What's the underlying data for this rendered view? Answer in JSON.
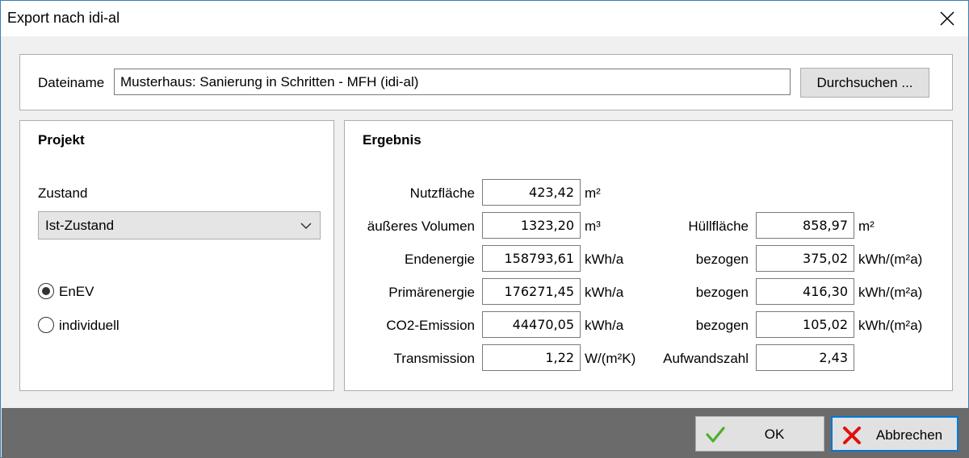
{
  "window": {
    "title": "Export nach idi-al"
  },
  "file": {
    "label": "Dateiname",
    "value": "Musterhaus: Sanierung in Schritten - MFH (idi-al)",
    "browse_label": "Durchsuchen ..."
  },
  "project": {
    "heading": "Projekt",
    "state_label": "Zustand",
    "state_value": "Ist-Zustand",
    "radio_enev": "EnEV",
    "radio_individual": "individuell",
    "selected": "EnEV"
  },
  "result": {
    "heading": "Ergebnis",
    "left": [
      {
        "label": "Nutzfläche",
        "value": "423,42",
        "unit": "m²"
      },
      {
        "label": "äußeres Volumen",
        "value": "1323,20",
        "unit": "m³"
      },
      {
        "label": "Endenergie",
        "value": "158793,61",
        "unit": "kWh/a"
      },
      {
        "label": "Primärenergie",
        "value": "176271,45",
        "unit": "kWh/a"
      },
      {
        "label": "CO2-Emission",
        "value": "44470,05",
        "unit": "kWh/a"
      },
      {
        "label": "Transmission",
        "value": "1,22",
        "unit": "W/(m²K)"
      }
    ],
    "right": [
      {
        "label": "Hüllfläche",
        "value": "858,97",
        "unit": "m²"
      },
      {
        "label": "bezogen",
        "value": "375,02",
        "unit": "kWh/(m²a)"
      },
      {
        "label": "bezogen",
        "value": "416,30",
        "unit": "kWh/(m²a)"
      },
      {
        "label": "bezogen",
        "value": "105,02",
        "unit": "kWh/(m²a)"
      },
      {
        "label": "Aufwandszahl",
        "value": "2,43",
        "unit": ""
      }
    ]
  },
  "footer": {
    "ok_label": "OK",
    "cancel_label": "Abbrechen"
  },
  "colors": {
    "ok_check": "#4caf2a",
    "cancel_x": "#e01010",
    "focus_border": "#0078d7"
  }
}
